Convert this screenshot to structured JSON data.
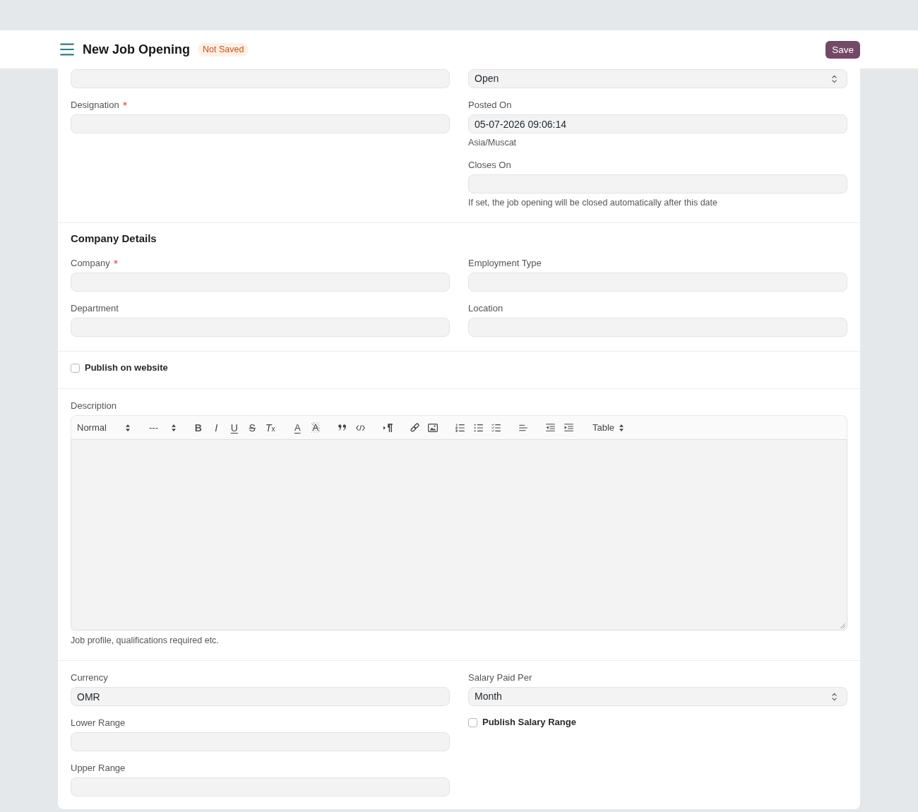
{
  "header": {
    "title": "New Job Opening",
    "status": "Not Saved",
    "action": "Save"
  },
  "sections": [
    {
      "kind": "columns",
      "columns": [
        [
          {
            "kind": "input"
          },
          {
            "kind": "input",
            "label": "Designation",
            "required": true
          }
        ],
        [
          {
            "kind": "select",
            "value": "Open"
          },
          {
            "kind": "input",
            "label": "Posted On",
            "required": false,
            "value": "05-07-2026 09:06:14",
            "help": "Asia/Muscat"
          },
          {
            "kind": "input",
            "label": "Closes On",
            "required": false,
            "help": "If set, the job opening will be closed automatically after this date"
          }
        ]
      ]
    },
    {
      "kind": "columns",
      "title": "Company Details",
      "columns": [
        [
          {
            "kind": "input",
            "label": "Company",
            "required": true
          },
          {
            "kind": "input",
            "label": "Department",
            "required": false
          }
        ],
        [
          {
            "kind": "input",
            "label": "Employment Type",
            "required": false
          },
          {
            "kind": "input",
            "label": "Location",
            "required": false
          }
        ]
      ]
    },
    {
      "kind": "columns",
      "columns": [
        [
          {
            "kind": "checkbox",
            "label": "Publish on website",
            "checked": false
          }
        ]
      ]
    },
    {
      "kind": "editor",
      "label": "Description",
      "required": false,
      "toolbar": [
        [
          {
            "kind": "heading-picker",
            "text": "Normal"
          }
        ],
        [
          {
            "kind": "size-picker",
            "text": "---"
          }
        ],
        [
          {
            "kind": "bold",
            "text": "B"
          },
          {
            "kind": "italic",
            "text": "I"
          },
          {
            "kind": "underline",
            "text": "U"
          },
          {
            "kind": "strike",
            "text": "S"
          },
          {
            "kind": "clean",
            "text": "T$_{x}$"
          }
        ],
        [
          {
            "kind": "color",
            "text": "A"
          },
          {
            "kind": "background",
            "text": "A"
          }
        ],
        [
          {
            "kind": "blockquote"
          },
          {
            "kind": "code-block"
          }
        ],
        [
          {
            "kind": "direction"
          }
        ],
        [
          {
            "kind": "link"
          },
          {
            "kind": "image"
          }
        ],
        [
          {
            "kind": "ordered-list"
          },
          {
            "kind": "bullet-list"
          },
          {
            "kind": "check-list"
          }
        ],
        [
          {
            "kind": "align"
          }
        ],
        [
          {
            "kind": "outdent"
          },
          {
            "kind": "indent"
          }
        ],
        [
          {
            "kind": "table-picker",
            "text": "Table"
          }
        ]
      ],
      "help": "Job profile, qualifications required etc."
    },
    {
      "kind": "columns",
      "columns": [
        [
          {
            "kind": "input",
            "label": "Currency",
            "required": false,
            "value": "OMR"
          },
          {
            "kind": "input",
            "label": "Lower Range",
            "required": false
          },
          {
            "kind": "input",
            "label": "Upper Range",
            "required": false
          }
        ],
        [
          {
            "kind": "select",
            "label": "Salary Paid Per",
            "required": false,
            "value": "Month"
          },
          {
            "kind": "checkbox",
            "label": "Publish Salary Range",
            "checked": false
          }
        ]
      ]
    }
  ]
}
